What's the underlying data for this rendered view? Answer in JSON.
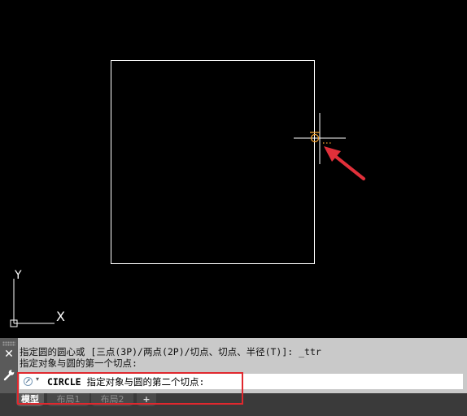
{
  "viewport": {
    "ucs_y_label": "Y",
    "ucs_x_label": "X",
    "colors": {
      "background": "#000000",
      "geometry": "#ffffff",
      "snap_marker": "#f0a030",
      "arrow": "#e0303a"
    }
  },
  "command_history": {
    "line1": "指定圆的圆心或 [三点(3P)/两点(2P)/切点、切点、半径(T)]: _ttr",
    "line2": "指定对象与圆的第一个切点:"
  },
  "command_line": {
    "command_name": "CIRCLE",
    "prompt": " 指定对象与圆的第二个切点:"
  },
  "tabs": [
    {
      "label": "模型"
    },
    {
      "label": "布局1"
    },
    {
      "label": "布局2"
    },
    {
      "label": "+"
    }
  ],
  "close_label": "✕",
  "dropdown_glyph": "▾",
  "highlight_color": "#e0282e"
}
